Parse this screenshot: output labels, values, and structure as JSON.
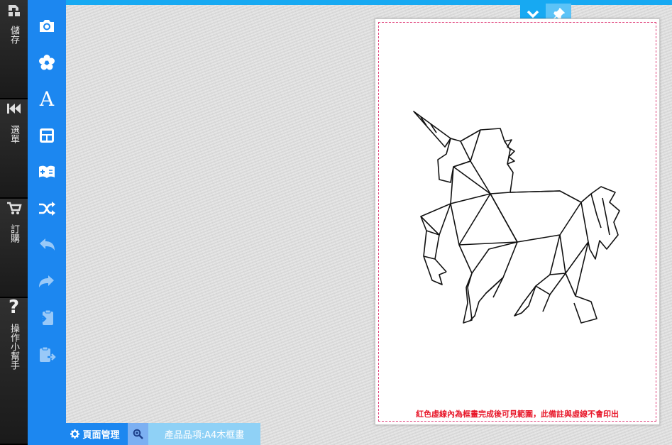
{
  "rail": {
    "save_label": "儲存",
    "menu_label": "選單",
    "order_label": "訂購",
    "help_label": "操作小幫手"
  },
  "tools": [
    {
      "icon": "camera-icon"
    },
    {
      "icon": "flower-icon"
    },
    {
      "icon": "text-icon",
      "glyph": "A"
    },
    {
      "icon": "layout-icon"
    },
    {
      "icon": "add-page-icon"
    },
    {
      "icon": "shuffle-icon"
    },
    {
      "icon": "undo-icon"
    },
    {
      "icon": "redo-icon"
    },
    {
      "icon": "paste-in-icon"
    },
    {
      "icon": "paste-out-icon"
    }
  ],
  "corner": {
    "collapse_icon": "chevron-down-icon",
    "pin_icon": "pin-icon"
  },
  "page": {
    "note": "紅色虛線內為框畫完成後可見範圍，此備註與虛線不會印出"
  },
  "bottom": {
    "pages_label": "頁面管理",
    "product_label": "產品品項:A4木框畫"
  },
  "colors": {
    "tool_column": "#1c87f0",
    "top_bar": "#17a9f2",
    "note_red": "#e8182a",
    "safe_line": "#e0407a"
  }
}
